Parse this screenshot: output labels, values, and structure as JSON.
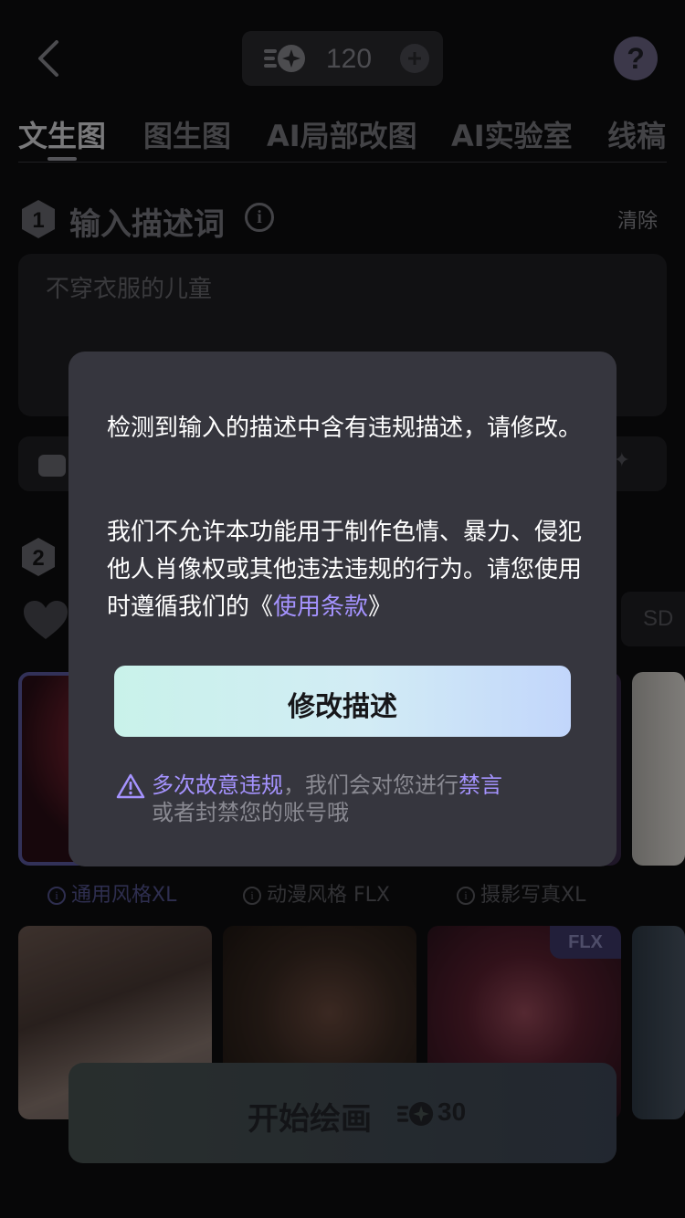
{
  "header": {
    "credits": "120"
  },
  "tabs": [
    {
      "label": "文生图",
      "active": true
    },
    {
      "label": "图生图",
      "active": false
    },
    {
      "label": "AI局部改图",
      "active": false
    },
    {
      "label": "AI实验室",
      "active": false
    },
    {
      "label": "线稿",
      "active": false
    }
  ],
  "section1": {
    "number": "1",
    "title": "输入描述词",
    "clear_label": "清除",
    "prompt_text": "不穿衣服的儿童"
  },
  "section2": {
    "number": "2",
    "model_chip": "SD"
  },
  "style_labels": [
    "通用风格XL",
    "动漫风格 FLX",
    "摄影写真XL"
  ],
  "gallery": {
    "badge": "FLX"
  },
  "start": {
    "label": "开始绘画",
    "cost": "30"
  },
  "modal": {
    "message_line": "检测到输入的描述中含有违规描述，请修改。",
    "policy_text": "我们不允许本功能用于制作色情、暴力、侵犯他人肖像权或其他违法违规的行为。请您使用时遵循我们的",
    "terms_open": "《",
    "terms_link": "使用条款",
    "terms_close": "》",
    "button_label": "修改描述",
    "warning_highlight_1": "多次故意违规",
    "warning_mid": "，我们会对您进行",
    "warning_highlight_2": "禁言",
    "warning_tail": "或者封禁您的账号哦"
  },
  "colors": {
    "accent": "#a593ff",
    "modal_bg": "#36363e",
    "button_gradient_start": "#c9f2ea",
    "button_gradient_end": "#c2d6fb"
  }
}
